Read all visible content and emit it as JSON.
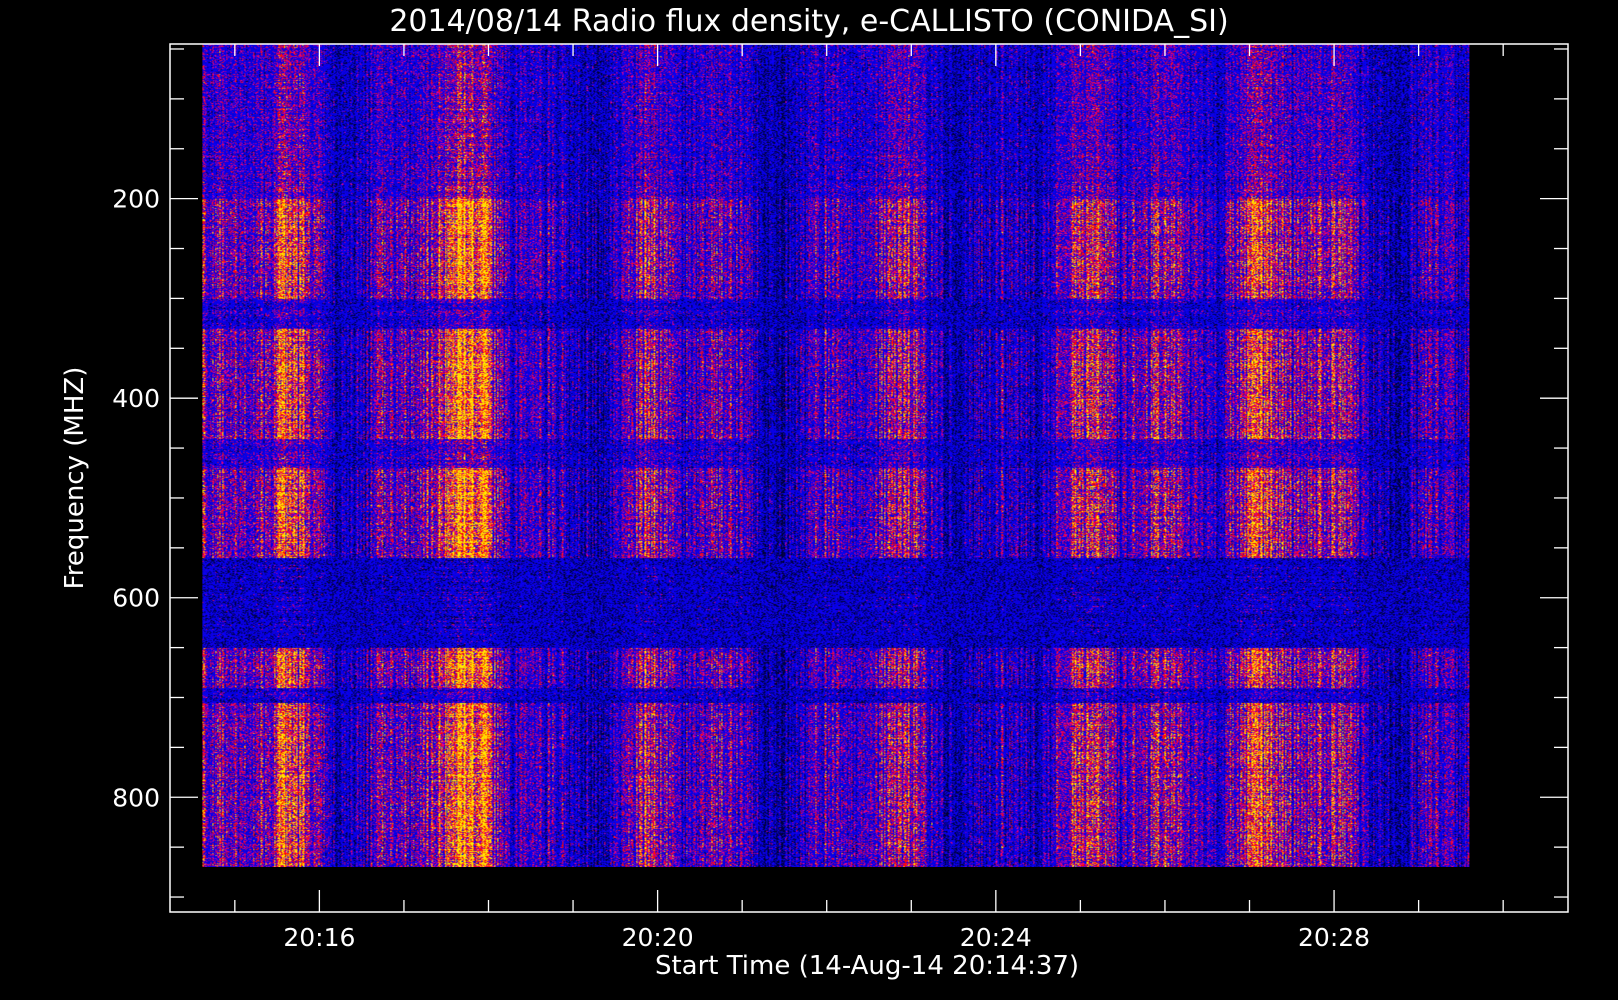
{
  "chart_data": {
    "type": "heatmap",
    "title": "2014/08/14  Radio flux density, e-CALLISTO (CONIDA_SI)",
    "xlabel": "Start Time (14-Aug-14 20:14:37)",
    "ylabel": "Frequency (MHZ)",
    "x_ticks": [
      "20:16",
      "20:20",
      "20:24",
      "20:28"
    ],
    "y_ticks": [
      "200",
      "400",
      "600",
      "800"
    ],
    "xlim": [
      "20:14:14",
      "20:30:46"
    ],
    "ylim": [
      45,
      915
    ],
    "y_inverted": true,
    "data_time_range": [
      "20:14:37",
      "20:29:36"
    ],
    "data_freq_range": [
      45,
      870
    ],
    "colormap": [
      "#000000",
      "#0000ff",
      "#ff0000",
      "#ffff00"
    ],
    "background": "#000000",
    "foreground": "#ffffff",
    "grid": false
  }
}
